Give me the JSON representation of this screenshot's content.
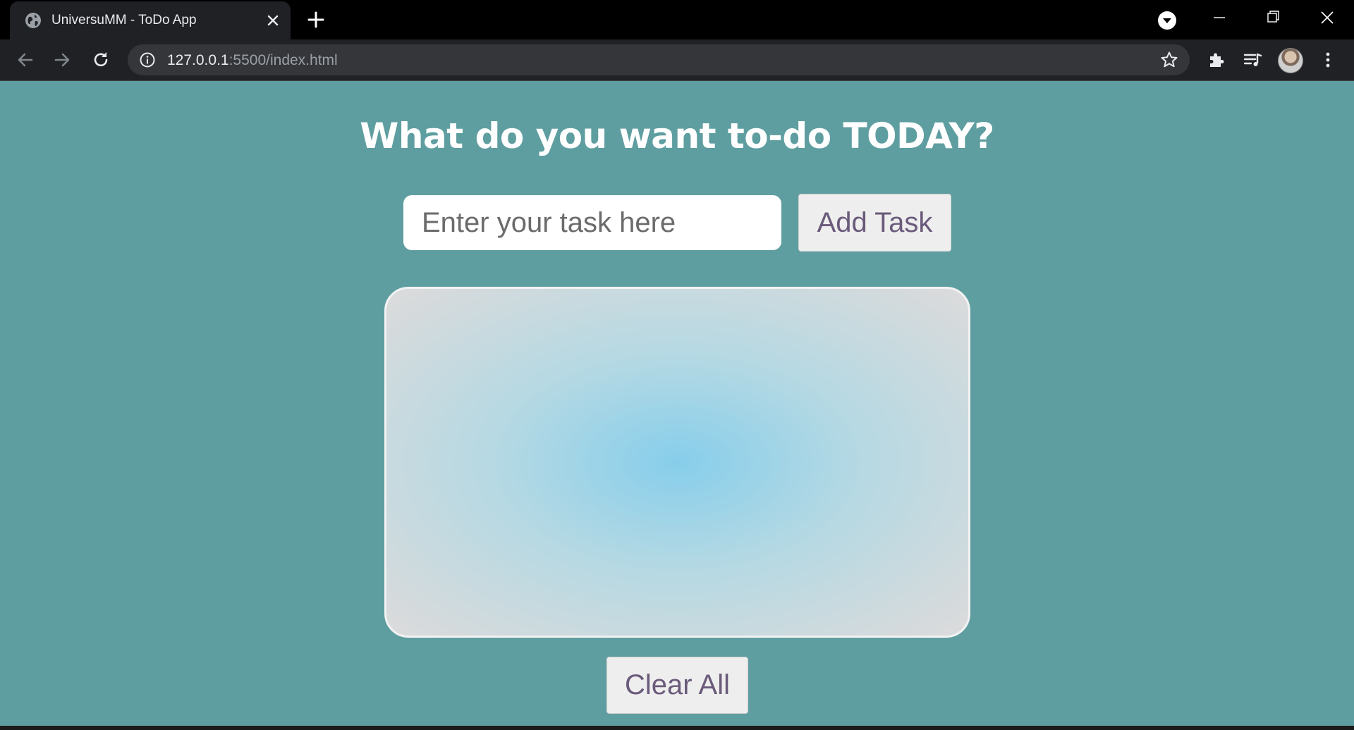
{
  "browser": {
    "tab": {
      "title": "UniversuMM - ToDo App"
    },
    "address_bar": {
      "host": "127.0.0.1",
      "rest": ":5500/index.html"
    }
  },
  "icons": {
    "favicon": "globe-icon",
    "tab_close": "close-icon",
    "new_tab": "plus-icon",
    "tab_search": "chevron-down-icon",
    "back": "arrow-left-icon",
    "forward": "arrow-right-icon",
    "reload": "reload-icon",
    "site_info": "info-icon",
    "bookmark": "star-icon",
    "extensions": "puzzle-icon",
    "media": "media-queue-icon",
    "menu": "kebab-menu-icon"
  },
  "app": {
    "heading": "What do you want to-do TODAY?",
    "input_placeholder": "Enter your task here",
    "add_label": "Add Task",
    "clear_label": "Clear All",
    "tasks": []
  },
  "colors": {
    "page_background": "#5f9ea0",
    "button_text": "#6a5a7b",
    "list_center": "#87ceeb",
    "list_edge": "#dcdcdc"
  }
}
